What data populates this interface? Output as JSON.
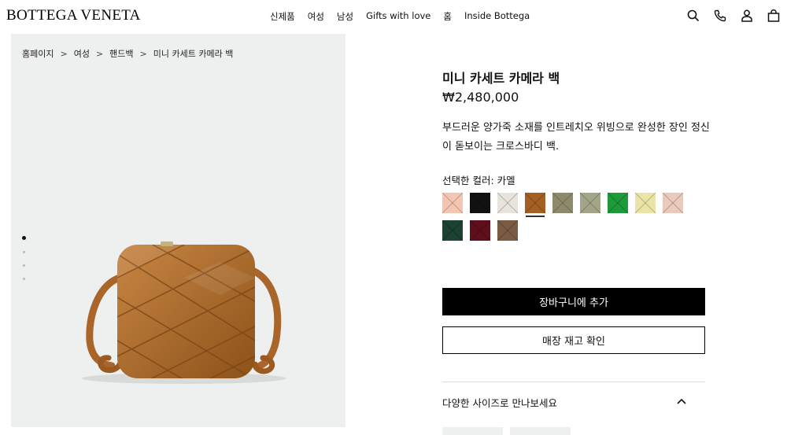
{
  "header": {
    "logo": "BOTTEGA VENETA",
    "nav": [
      "신제품",
      "여성",
      "남성",
      "Gifts with love",
      "홈",
      "Inside Bottega"
    ],
    "icons": [
      "search-icon",
      "phone-icon",
      "account-icon",
      "bag-icon"
    ]
  },
  "breadcrumb": [
    "홈페이지",
    "여성",
    "핸드백",
    "미니 카세트 카메라 백"
  ],
  "breadcrumb_separator": ">",
  "gallery": {
    "image_count": 4,
    "active_index": 0
  },
  "product": {
    "title": "미니 카세트 카메라 백",
    "price": "₩2,480,000",
    "description": "부드러운 양가죽 소재를 인트레치오 위빙으로 완성한 장인 정신이 돋보이는 크로스바디 백.",
    "color_label": "선택한 컬러: 카멜",
    "swatches": [
      {
        "name": "peach",
        "color": "#f2c6b1"
      },
      {
        "name": "black",
        "color": "#111111"
      },
      {
        "name": "chalk",
        "color": "#e7e4de"
      },
      {
        "name": "camel",
        "color": "#a45f22",
        "selected": true
      },
      {
        "name": "olive-taupe",
        "color": "#8d8a6c"
      },
      {
        "name": "sage",
        "color": "#a3a588"
      },
      {
        "name": "green",
        "color": "#1f9a3a"
      },
      {
        "name": "butter",
        "color": "#eae4a7"
      },
      {
        "name": "blush",
        "color": "#eacabd"
      },
      {
        "name": "dark-green",
        "color": "#1c4231"
      },
      {
        "name": "burgundy",
        "color": "#5e0f1b"
      },
      {
        "name": "brown",
        "color": "#7a5c45"
      }
    ],
    "add_to_cart": "장바구니에 추가",
    "check_store": "매장 재고 확인",
    "sizes_label": "다양한 사이즈로 만나보세요"
  }
}
